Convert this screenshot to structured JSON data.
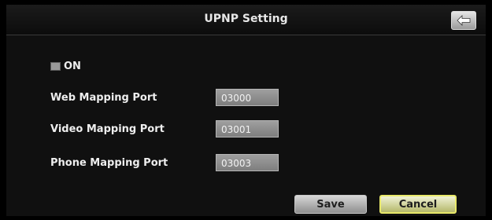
{
  "header": {
    "title": "UPNP Setting",
    "back_icon": "back-arrow-icon"
  },
  "upnp": {
    "enabled": false,
    "toggle_label": "ON"
  },
  "fields": [
    {
      "label": "Web Mapping Port",
      "value": "03000"
    },
    {
      "label": "Video Mapping Port",
      "value": "03001"
    },
    {
      "label": "Phone Mapping Port",
      "value": "03003"
    }
  ],
  "actions": {
    "save_label": "Save",
    "cancel_label": "Cancel"
  },
  "colors": {
    "background": "#000000",
    "accent_border": "#e8e86a"
  }
}
